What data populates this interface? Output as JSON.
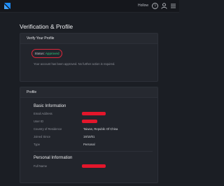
{
  "header": {
    "logo": "lightning-logo",
    "link_label": "Hollow",
    "icons": [
      "help-icon",
      "user-icon",
      "menu-icon"
    ]
  },
  "page": {
    "title": "Verification & Profile"
  },
  "verify": {
    "title": "Verify Your Profile",
    "status_label": "Status:",
    "status_value": "Approved",
    "status_color": "#2ecf7f",
    "note": "Your account has been approved. No further action is required."
  },
  "profile": {
    "title": "Profile",
    "basic": {
      "heading": "Basic Information",
      "fields": [
        {
          "label": "Email Address",
          "value": "",
          "redacted": true
        },
        {
          "label": "User ID",
          "value": "",
          "redacted": true
        },
        {
          "label": "Country of Residence",
          "value": "Taiwan, Republic Of China"
        },
        {
          "label": "Joined Since",
          "value": "19/10/01"
        },
        {
          "label": "Type",
          "value": "Personal"
        }
      ]
    },
    "personal": {
      "heading": "Personal Information",
      "fields": [
        {
          "label": "Full Name",
          "value": "",
          "redacted": true
        }
      ]
    }
  },
  "colors": {
    "accent": "#1a8cff",
    "redaction": "#e3162b",
    "highlight_ring": "#e0263a"
  }
}
